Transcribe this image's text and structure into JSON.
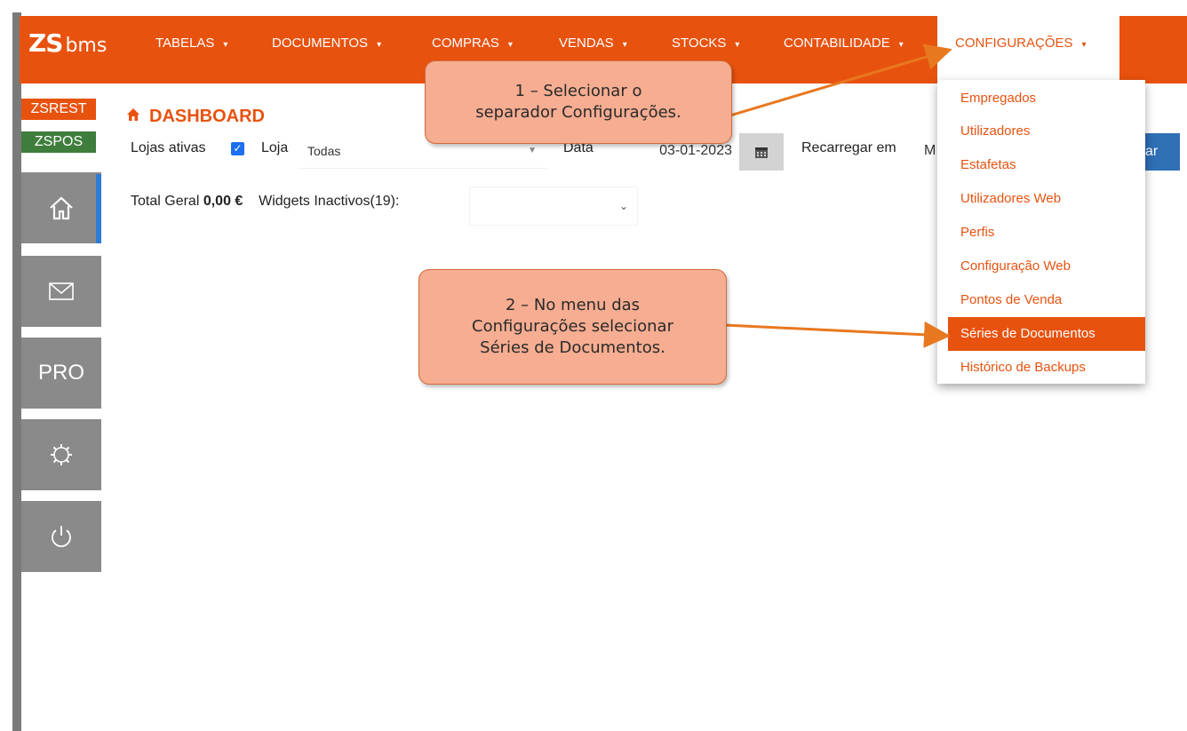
{
  "app": {
    "logo_zs": "ZS",
    "logo_bms": "bms"
  },
  "nav": {
    "items": [
      {
        "label": "TABELAS"
      },
      {
        "label": "DOCUMENTOS"
      },
      {
        "label": "COMPRAS"
      },
      {
        "label": "VENDAS"
      },
      {
        "label": "STOCKS"
      },
      {
        "label": "CONTABILIDADE"
      }
    ],
    "active_label": "CONFIGURAÇÕES",
    "caret": "▾"
  },
  "sidebar": {
    "badge_zsrest": "ZSREST",
    "badge_zspos": "ZSPOS",
    "pro_label": "PRO"
  },
  "dashboard": {
    "title": "DASHBOARD",
    "lojas_ativas_label": "Lojas ativas",
    "loja_label": "Loja",
    "loja_value": "Todas",
    "data_label": "Data",
    "data_value": "03-01-2023",
    "recarregar_label": "Recarregar em",
    "recarregar_value": "M",
    "button_label": "ar",
    "total_geral_label": "Total Geral",
    "total_geral_value": "0,00 €",
    "widgets_label": "Widgets Inactivos(19):"
  },
  "dropdown": {
    "items": [
      {
        "label": "Empregados"
      },
      {
        "label": "Utilizadores"
      },
      {
        "label": "Estafetas"
      },
      {
        "label": "Utilizadores Web"
      },
      {
        "label": "Perfis"
      },
      {
        "label": "Configuração Web"
      },
      {
        "label": "Pontos de Venda"
      },
      {
        "label": "Séries de Documentos",
        "selected": true
      },
      {
        "label": "Histórico de Backups"
      }
    ]
  },
  "callouts": {
    "step1_line1": "1 – Selecionar o",
    "step1_line2": "separador Configurações.",
    "step2_line1": "2 – No menu das",
    "step2_line2": "Configurações selecionar",
    "step2_line3": "Séries de Documentos."
  },
  "colors": {
    "brand": "#e8520f",
    "sidebar_gray": "#8a8a8a",
    "zspos_green": "#3f7d3c",
    "callout_fill": "#f6ad91",
    "primary_blue": "#2f6fb5"
  }
}
